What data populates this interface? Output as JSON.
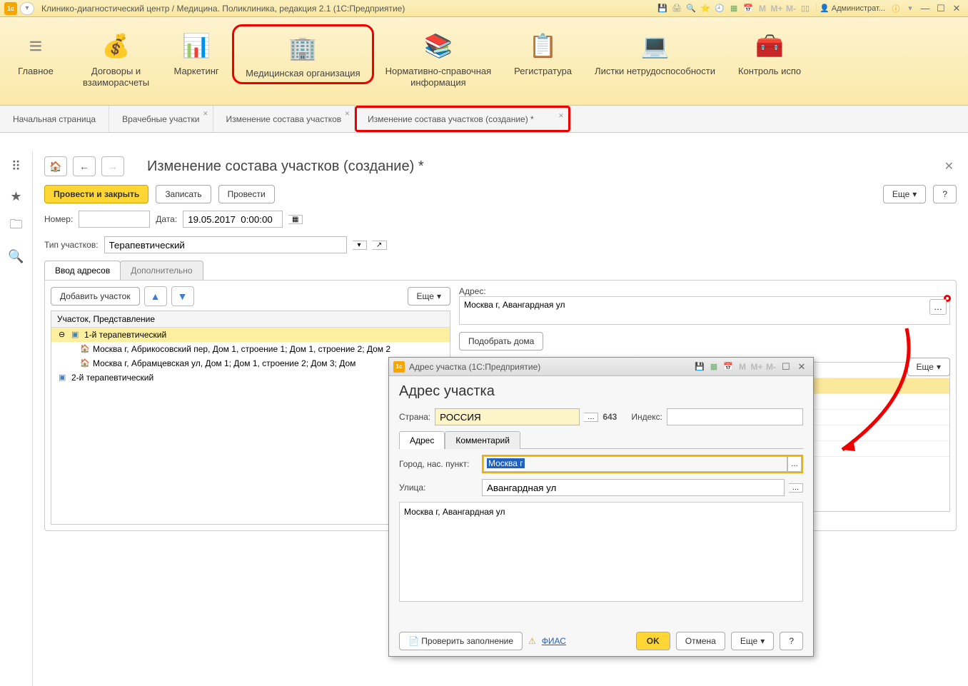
{
  "titlebar": {
    "text": "Клинико-диагностический центр / Медицина. Поликлиника, редакция 2.1  (1С:Предприятие)",
    "user": "Администрат..."
  },
  "ribbon": {
    "items": [
      {
        "label": "Главное",
        "icon": "≡"
      },
      {
        "label": "Договоры и\nвзаиморасчеты",
        "icon": "💰"
      },
      {
        "label": "Маркетинг",
        "icon": "📊"
      },
      {
        "label": "Медицинская организация",
        "icon": "🏢",
        "highlighted": true
      },
      {
        "label": "Нормативно-справочная\nинформация",
        "icon": "📚"
      },
      {
        "label": "Регистратура",
        "icon": "📋"
      },
      {
        "label": "Листки нетрудоспособности",
        "icon": "💻"
      },
      {
        "label": "Контроль испо",
        "icon": "🧰"
      }
    ]
  },
  "tabs": [
    {
      "label": "Начальная страница"
    },
    {
      "label": "Врачебные участки",
      "closable": true
    },
    {
      "label": "Изменение состава участков",
      "closable": true
    },
    {
      "label": "Изменение состава участков (создание) *",
      "closable": true,
      "highlighted": true
    }
  ],
  "page": {
    "title": "Изменение состава участков (создание) *",
    "actions": {
      "primary": "Провести и закрыть",
      "save": "Записать",
      "post": "Провести",
      "more": "Еще",
      "help": "?"
    },
    "form": {
      "number_label": "Номер:",
      "number_value": "",
      "date_label": "Дата:",
      "date_value": "19.05.2017  0:00:00",
      "type_label": "Тип участков:",
      "type_value": "Терапевтический"
    },
    "subtabs": {
      "tab1": "Ввод адресов",
      "tab2": "Дополнительно"
    },
    "left": {
      "add_btn": "Добавить участок",
      "more": "Еще",
      "tree_header": "Участок, Представление",
      "rows": [
        {
          "level": 1,
          "text": "1-й терапевтический",
          "selected": true,
          "expand": "⊖"
        },
        {
          "level": 2,
          "text": "Москва г, Абрикосовский пер, Дом 1, строение 1; Дом 1, строение 2; Дом 2"
        },
        {
          "level": 2,
          "text": "Москва г, Абрамцевская ул, Дом 1; Дом 1, строение 2; Дом 3; Дом"
        },
        {
          "level": 1,
          "text": "2-й терапевтический",
          "expand": ""
        }
      ]
    },
    "right": {
      "addr_label": "Адрес:",
      "addr_value": "Москва г, Авангардная ул",
      "pick_houses": "Подобрать дома",
      "more": "Еще"
    }
  },
  "dialog": {
    "title": "Адрес участка  (1С:Предприятие)",
    "heading": "Адрес участка",
    "country_label": "Страна:",
    "country_value": "РОССИЯ",
    "country_code": "643",
    "index_label": "Индекс:",
    "index_value": "",
    "tabs": {
      "t1": "Адрес",
      "t2": "Комментарий"
    },
    "city_label": "Город, нас. пункт:",
    "city_value": "Москва г",
    "street_label": "Улица:",
    "street_value": "Авангардная ул",
    "preview": "Москва г, Авангардная ул",
    "footer": {
      "check": "Проверить заполнение",
      "fias": "ФИАС",
      "ok": "OK",
      "cancel": "Отмена",
      "more": "Еще",
      "help": "?"
    }
  }
}
